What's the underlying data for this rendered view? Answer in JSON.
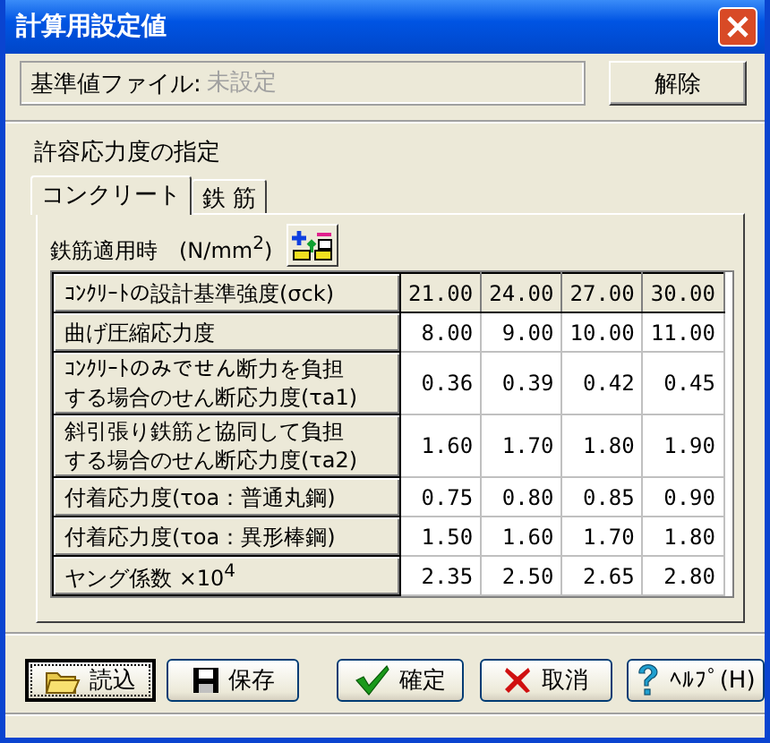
{
  "window": {
    "title": "計算用設定値"
  },
  "file": {
    "label": "基準値ファイル:",
    "placeholder": "未設定",
    "button": "解除"
  },
  "group_label": "許容応力度の指定",
  "tabs": [
    {
      "label": "コンクリート",
      "selected": true
    },
    {
      "label": "鉄 筋",
      "selected": false
    }
  ],
  "unit_label": "鉄筋適用時　(N/mm$^{2}$)",
  "table": {
    "columns": [
      "ｺﾝｸﾘｰﾄの設計基準強度(σck)",
      "21.00",
      "24.00",
      "27.00",
      "30.00"
    ],
    "rows": [
      {
        "label": "曲げ圧縮応力度",
        "values": [
          "8.00",
          "9.00",
          "10.00",
          "11.00"
        ]
      },
      {
        "label": "ｺﾝｸﾘｰﾄのみでせん断力を負担する場合のせん断応力度(τa1)",
        "values": [
          "0.36",
          "0.39",
          "0.42",
          "0.45"
        ]
      },
      {
        "label": "斜引張り鉄筋と協同して負担する場合のせん断応力度(τa2)",
        "values": [
          "1.60",
          "1.70",
          "1.80",
          "1.90"
        ]
      },
      {
        "label": "付着応力度(τoa：普通丸鋼)",
        "values": [
          "0.75",
          "0.80",
          "0.85",
          "0.90"
        ]
      },
      {
        "label": "付着応力度(τoa：異形棒鋼)",
        "values": [
          "1.50",
          "1.60",
          "1.70",
          "1.80"
        ]
      },
      {
        "label": "ヤング係数 ×10$^{4}$",
        "values": [
          "2.35",
          "2.50",
          "2.65",
          "2.80"
        ]
      }
    ]
  },
  "buttons": [
    {
      "label": "読込",
      "kind": "open",
      "focused": true
    },
    {
      "label": "保存",
      "kind": "save",
      "focused": false
    },
    {
      "label": "確定",
      "kind": "ok",
      "focused": false
    },
    {
      "label": "取消",
      "kind": "cancel",
      "focused": false
    },
    {
      "label": "ﾍﾙﾌﾟ(H)",
      "kind": "help",
      "focused": false
    }
  ]
}
